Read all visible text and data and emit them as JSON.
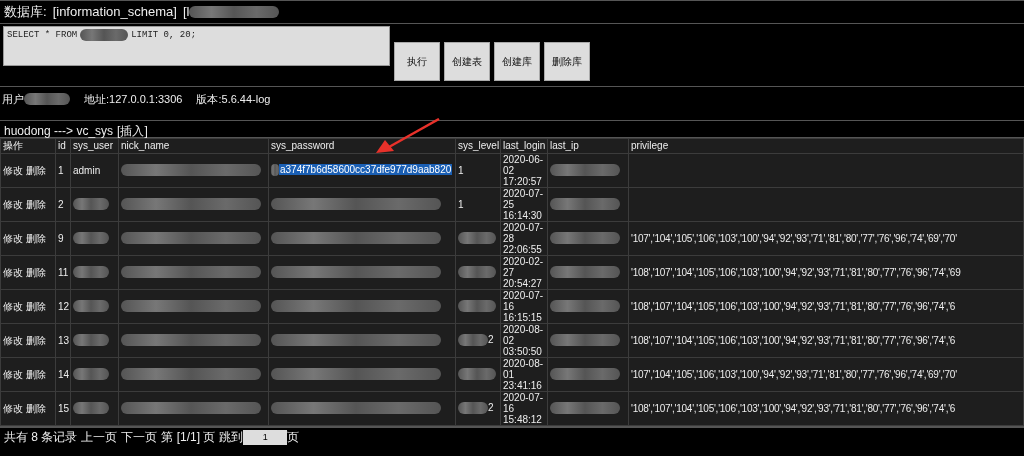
{
  "database_bar": {
    "label": "数据库:",
    "database": "[information_schema]",
    "other_prefix": "[l"
  },
  "query": {
    "before": "SELECT * FROM",
    "after": "LIMIT 0, 20;"
  },
  "buttons": [
    "执行",
    "创建表",
    "创建库",
    "删除库"
  ],
  "server_info": {
    "user_label": "用户",
    "address": "地址:127.0.0.1:3306",
    "version": "版本:5.6.44-log"
  },
  "breadcrumb": {
    "path": "huodong ---> vc_sys",
    "action": "[插入]"
  },
  "table": {
    "columns": [
      "操作",
      "id",
      "sys_user",
      "nick_name",
      "sys_password",
      "sys_level",
      "last_login",
      "last_ip",
      "privilege"
    ],
    "rows": [
      {
        "cells": [
          {
            "kind": "actions",
            "links": [
              "修改",
              "删除"
            ]
          },
          {
            "kind": "text",
            "text": "1"
          },
          {
            "kind": "text",
            "text": "admin"
          },
          {
            "kind": "redacted"
          },
          {
            "kind": "partly_redacted",
            "text": "a374f7b6d58600cc37dfe977d9aab820",
            "selected": true
          },
          {
            "kind": "text",
            "text": "1"
          },
          {
            "kind": "text",
            "text": "2020-06-02 17:20:57"
          },
          {
            "kind": "redacted"
          },
          {
            "kind": "empty"
          }
        ]
      },
      {
        "cells": [
          {
            "kind": "actions",
            "links": [
              "修改",
              "删除"
            ]
          },
          {
            "kind": "text",
            "text": "2"
          },
          {
            "kind": "redacted"
          },
          {
            "kind": "redacted"
          },
          {
            "kind": "redacted",
            "selected": false
          },
          {
            "kind": "text",
            "text": "1"
          },
          {
            "kind": "text",
            "text": "2020-07-25 16:14:30"
          },
          {
            "kind": "redacted"
          },
          {
            "kind": "empty"
          }
        ]
      },
      {
        "cells": [
          {
            "kind": "actions",
            "links": [
              "修改",
              "删除"
            ]
          },
          {
            "kind": "text",
            "text": "9"
          },
          {
            "kind": "redacted"
          },
          {
            "kind": "redacted"
          },
          {
            "kind": "redacted",
            "selected": false
          },
          {
            "kind": "redacted"
          },
          {
            "kind": "text",
            "text": "2020-07-28 22:06:55"
          },
          {
            "kind": "redacted"
          },
          {
            "kind": "text",
            "text": "'107','104','105','106','103','100','94','92','93','71','81','80','77','76','96','74','69','70'"
          }
        ]
      },
      {
        "cells": [
          {
            "kind": "actions",
            "links": [
              "修改",
              "删除"
            ]
          },
          {
            "kind": "text",
            "text": "11"
          },
          {
            "kind": "redacted"
          },
          {
            "kind": "redacted"
          },
          {
            "kind": "redacted",
            "selected": false
          },
          {
            "kind": "redacted"
          },
          {
            "kind": "text",
            "text": "2020-02-27 20:54:27"
          },
          {
            "kind": "redacted"
          },
          {
            "kind": "text",
            "text": "'108','107','104','105','106','103','100','94','92','93','71','81','80','77','76','96','74','69"
          }
        ]
      },
      {
        "cells": [
          {
            "kind": "actions",
            "links": [
              "修改",
              "删除"
            ]
          },
          {
            "kind": "text",
            "text": "12"
          },
          {
            "kind": "redacted"
          },
          {
            "kind": "redacted"
          },
          {
            "kind": "redacted",
            "selected": false
          },
          {
            "kind": "redacted"
          },
          {
            "kind": "text",
            "text": "2020-07-16 16:15:15"
          },
          {
            "kind": "redacted"
          },
          {
            "kind": "text",
            "text": "'108','107','104','105','106','103','100','94','92','93','71','81','80','77','76','96','74','6"
          }
        ]
      },
      {
        "cells": [
          {
            "kind": "actions",
            "links": [
              "修改",
              "删除"
            ]
          },
          {
            "kind": "text",
            "text": "13"
          },
          {
            "kind": "redacted"
          },
          {
            "kind": "redacted"
          },
          {
            "kind": "redacted",
            "selected": false
          },
          {
            "kind": "partly_redacted",
            "text": "2"
          },
          {
            "kind": "text",
            "text": "2020-08-02 03:50:50"
          },
          {
            "kind": "redacted"
          },
          {
            "kind": "text",
            "text": "'108','107','104','105','106','103','100','94','92','93','71','81','80','77','76','96','74','6"
          }
        ]
      },
      {
        "cells": [
          {
            "kind": "actions",
            "links": [
              "修改",
              "删除"
            ]
          },
          {
            "kind": "text",
            "text": "14"
          },
          {
            "kind": "redacted"
          },
          {
            "kind": "redacted"
          },
          {
            "kind": "redacted",
            "selected": false
          },
          {
            "kind": "redacted"
          },
          {
            "kind": "text",
            "text": "2020-08-01 23:41:16"
          },
          {
            "kind": "redacted"
          },
          {
            "kind": "text",
            "text": "'107','104','105','106','103','100','94','92','93','71','81','80','77','76','96','74','69','70'"
          }
        ]
      },
      {
        "cells": [
          {
            "kind": "actions",
            "links": [
              "修改",
              "删除"
            ]
          },
          {
            "kind": "text",
            "text": "15"
          },
          {
            "kind": "redacted"
          },
          {
            "kind": "redacted"
          },
          {
            "kind": "redacted",
            "selected": false
          },
          {
            "kind": "partly_redacted",
            "text": "2"
          },
          {
            "kind": "text",
            "text": "2020-07-16 15:48:12"
          },
          {
            "kind": "redacted"
          },
          {
            "kind": "text",
            "text": "'108','107','104','105','106','103','100','94','92','93','71','81','80','77','76','96','74','6"
          }
        ]
      }
    ]
  },
  "pager": {
    "summary": "共有 8 条记录",
    "prev": "上一页",
    "next": "下一页",
    "page": "第 [1/1] 页",
    "jump_label": "跳到",
    "jump_value": "1",
    "jump_suffix": "页"
  },
  "annotation": {
    "kind": "arrow"
  }
}
